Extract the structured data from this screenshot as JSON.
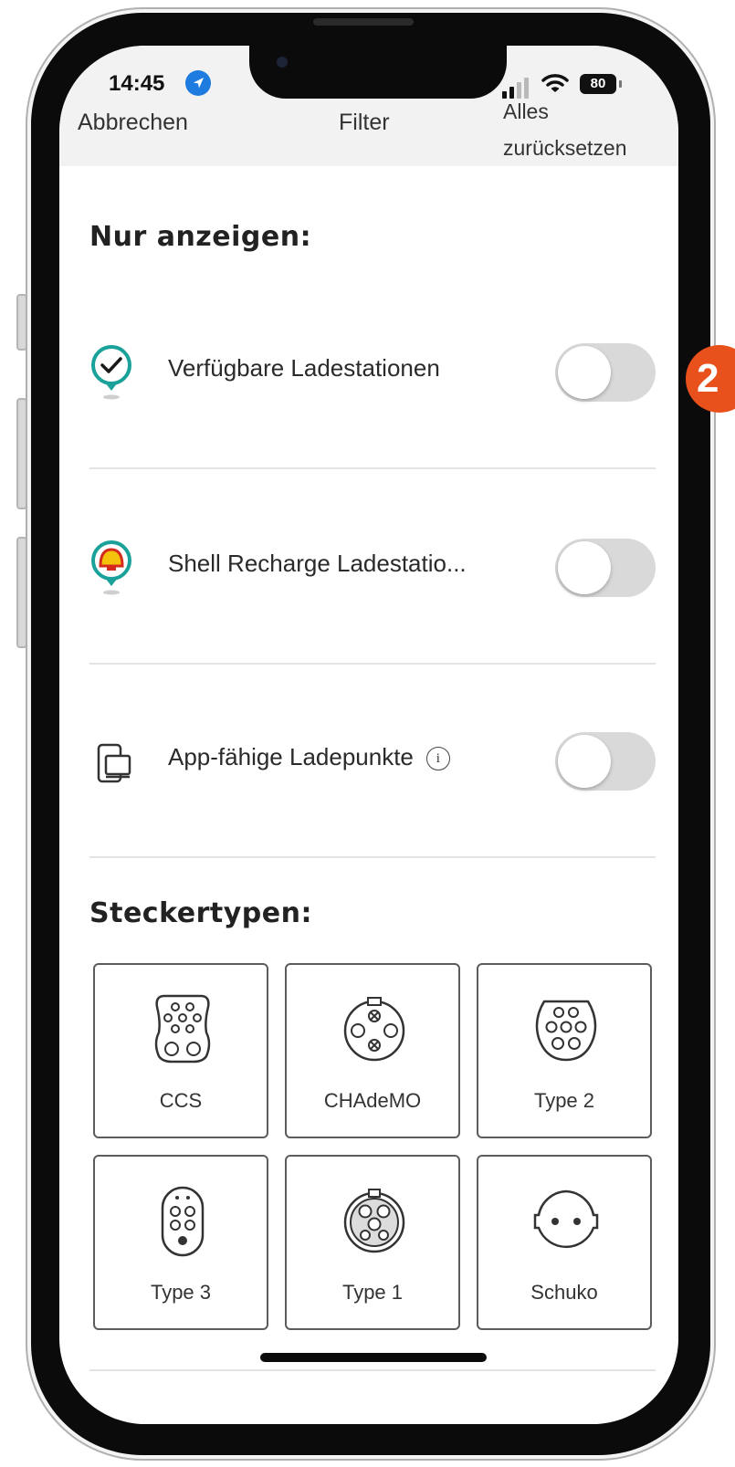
{
  "status_bar": {
    "time": "14:45",
    "battery": "80"
  },
  "nav": {
    "cancel": "Abbrechen",
    "title": "Filter",
    "reset_line1": "Alles",
    "reset_line2": "zurücksetzen"
  },
  "filters": {
    "title": "Nur anzeigen:",
    "items": [
      {
        "label": "Verfügbare Ladestationen",
        "icon": "check-pin-icon",
        "enabled": false
      },
      {
        "label": "Shell Recharge Ladestatio...",
        "icon": "shell-pin-icon",
        "enabled": false
      },
      {
        "label": "App-fähige Ladepunkte",
        "icon": "app-devices-icon",
        "enabled": false,
        "info_icon": "i"
      }
    ]
  },
  "plugs": {
    "title": "Steckertypen:",
    "items": [
      {
        "label": "CCS",
        "icon": "ccs-plug-icon"
      },
      {
        "label": "CHAdeMO",
        "icon": "chademo-plug-icon"
      },
      {
        "label": "Type 2",
        "icon": "type2-plug-icon"
      },
      {
        "label": "Type 3",
        "icon": "type3-plug-icon"
      },
      {
        "label": "Type 1",
        "icon": "type1-plug-icon"
      },
      {
        "label": "Schuko",
        "icon": "schuko-plug-icon"
      }
    ]
  },
  "step_badge": "2",
  "colors": {
    "accent_teal": "#1aa19a",
    "badge_orange": "#e8501c",
    "toggle_off": "#d9d9d9"
  }
}
